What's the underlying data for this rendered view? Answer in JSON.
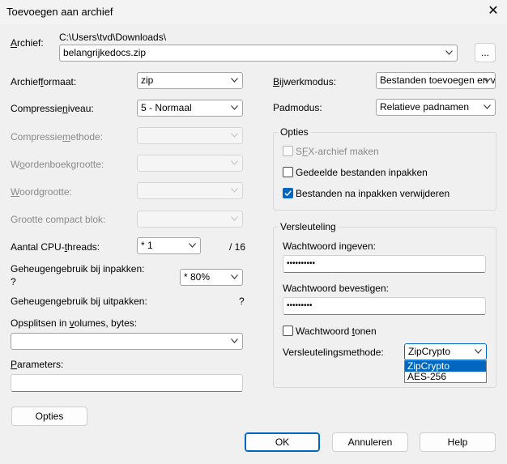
{
  "window": {
    "title": "Toevoegen aan archief",
    "close_glyph": "✕"
  },
  "archive": {
    "label": "Archief:",
    "path": "C:\\Users\\tvd\\Downloads\\",
    "filename": "belangrijkedocs.zip",
    "browse_label": "..."
  },
  "left": {
    "format_label": "Archiefformaat:",
    "format_value": "zip",
    "level_label": "Compressieniveau:",
    "level_value": "5 - Normaal",
    "method_label": "Compressiemethode:",
    "dict_label": "Woordenboekgrootte:",
    "word_label": "Woordgrootte:",
    "solid_label": "Grootte compact blok:",
    "cpu_label": "Aantal CPU-threads:",
    "cpu_value": "* 1",
    "cpu_max": "/ 16",
    "mem_pack_label": "Geheugengebruik bij inpakken:",
    "mem_pack_q": "?",
    "mem_pack_value": "* 80%",
    "mem_unpack_label": "Geheugengebruik bij uitpakken:",
    "mem_unpack_value": "?",
    "split_label": "Opsplitsen in volumes, bytes:",
    "split_value": "",
    "params_label": "Parameters:",
    "params_value": "",
    "options_button": "Opties"
  },
  "right": {
    "update_label": "Bijwerkmodus:",
    "update_value": "Bestanden toevoegen en v",
    "path_label": "Padmodus:",
    "path_value": "Relatieve padnamen",
    "options_group": "Opties",
    "sfx_label": "SFX-archief maken",
    "shared_label": "Gedeelde bestanden inpakken",
    "delete_label": "Bestanden na inpakken verwijderen",
    "enc_group": "Versleuteling",
    "pw_label": "Wachtwoord ingeven:",
    "pw_value": "••••••••••",
    "pw2_label": "Wachtwoord bevestigen:",
    "pw2_value": "•••••••••",
    "show_pw_label": "Wachtwoord tonen",
    "enc_method_label": "Versleutelingsmethode:",
    "enc_method_value": "ZipCrypto",
    "enc_options": [
      "ZipCrypto",
      "AES-256"
    ]
  },
  "footer": {
    "ok": "OK",
    "cancel": "Annuleren",
    "help": "Help"
  },
  "state": {
    "sfx_checked": false,
    "shared_checked": false,
    "delete_checked": true,
    "show_pw_checked": false
  },
  "colors": {
    "accent": "#0067c0",
    "background": "#f0f0f0"
  }
}
